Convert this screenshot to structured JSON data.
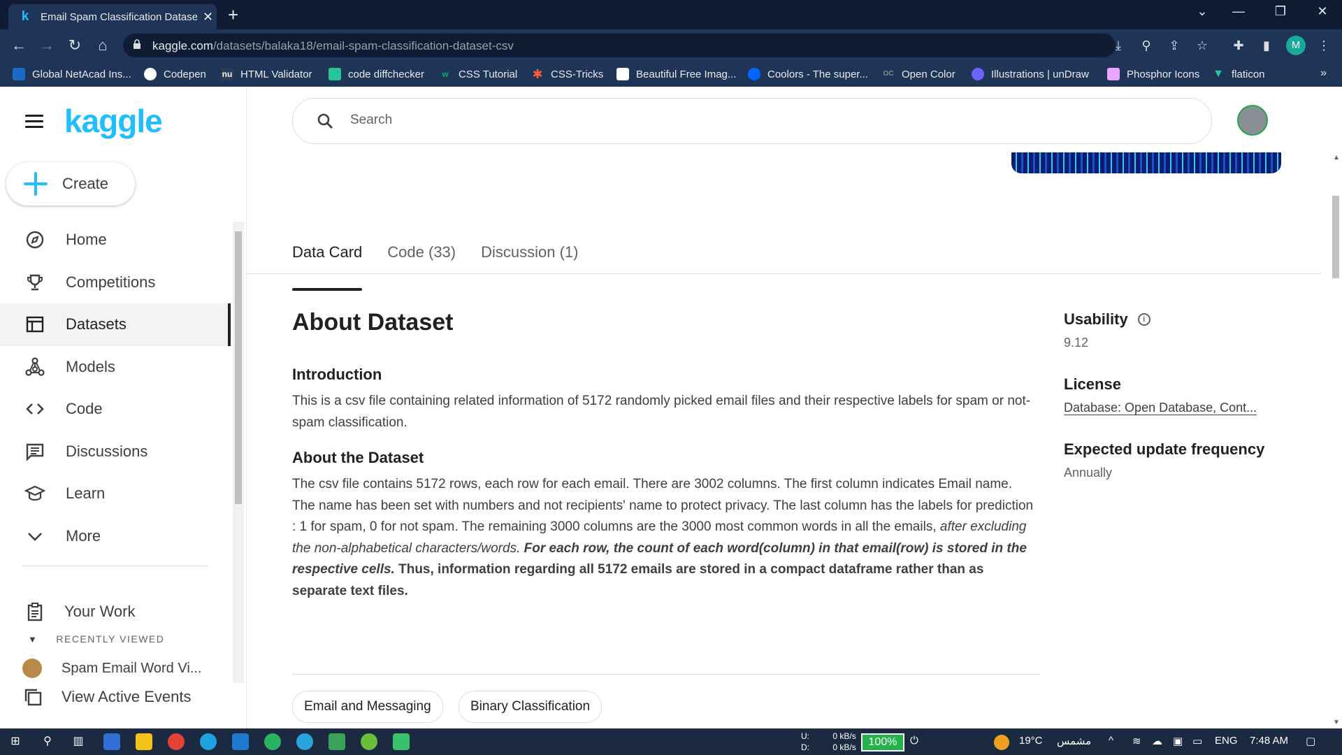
{
  "browser": {
    "tab": {
      "title": "Email Spam Classification Datase",
      "favicon": "k",
      "close": "✕"
    },
    "new_tab": "+",
    "url": {
      "host": "kaggle.com",
      "path": "/datasets/balaka18/email-spam-classification-dataset-csv"
    },
    "profile_initial": "M",
    "bookmarks": [
      {
        "label": "Global NetAcad Ins...",
        "icon": "cisco-icon",
        "color": "#1b6ac9"
      },
      {
        "label": "Codepen",
        "icon": "codepen-icon",
        "color": "#ffffff"
      },
      {
        "label": "HTML Validator",
        "icon": "validator-icon",
        "color": "#2b3a55"
      },
      {
        "label": "code diffchecker",
        "icon": "diffchecker-icon",
        "color": "#27c499"
      },
      {
        "label": "CSS Tutorial",
        "icon": "w3schools-icon",
        "color": "#04aa6d"
      },
      {
        "label": "CSS-Tricks",
        "icon": "css-tricks-icon",
        "color": "#ff5a3c"
      },
      {
        "label": "Beautiful Free Imag...",
        "icon": "unsplash-icon",
        "color": "#ffffff"
      },
      {
        "label": "Coolors - The super...",
        "icon": "coolors-icon",
        "color": "#0066ff"
      },
      {
        "label": "Open Color",
        "icon": "open-color-icon",
        "color": "#868e96"
      },
      {
        "label": "Illustrations | unDraw",
        "icon": "undraw-icon",
        "color": "#6c63ff"
      },
      {
        "label": "Phosphor Icons",
        "icon": "phosphor-icon",
        "color": "#e9a5ff"
      },
      {
        "label": "flaticon",
        "icon": "flaticon-icon",
        "color": "#27c499"
      }
    ],
    "bookmarks_more": "»"
  },
  "sidebar": {
    "logo": "kaggle",
    "create_label": "Create",
    "items": [
      {
        "label": "Home",
        "icon": "compass-icon",
        "glyph": "◎"
      },
      {
        "label": "Competitions",
        "icon": "trophy-icon",
        "glyph": "🏆"
      },
      {
        "label": "Datasets",
        "icon": "table-icon",
        "glyph": "▦"
      },
      {
        "label": "Models",
        "icon": "models-icon",
        "glyph": "⁂"
      },
      {
        "label": "Code",
        "icon": "code-icon",
        "glyph": "‹›"
      },
      {
        "label": "Discussions",
        "icon": "discussions-icon",
        "glyph": "▤"
      },
      {
        "label": "Learn",
        "icon": "learn-icon",
        "glyph": "🎓"
      },
      {
        "label": "More",
        "icon": "chevron-down-icon",
        "glyph": "⌄"
      }
    ],
    "your_work": "Your Work",
    "recently_viewed_header": "RECENTLY VIEWED",
    "recent_item": "Spam Email Word Vi...",
    "view_active_events": "View Active Events"
  },
  "header": {
    "search_placeholder": "Search"
  },
  "tabs": [
    {
      "label": "Data Card",
      "active": true
    },
    {
      "label": "Code (33)",
      "active": false
    },
    {
      "label": "Discussion (1)",
      "active": false
    }
  ],
  "content": {
    "title": "About Dataset",
    "intro_heading": "Introduction",
    "intro_text": "This is a csv file containing related information of 5172 randomly picked email files and their respective labels for spam or not-spam classification.",
    "about_heading": "About the Dataset",
    "about_text_plain": "The csv file contains 5172 rows, each row for each email. There are 3002 columns. The first column indicates Email name. The name has been set with numbers and not recipients' name to protect privacy. The last column has the labels for prediction : 1 for spam, 0 for not spam. The remaining 3000 columns are the 3000 most common words in all the emails, ",
    "about_text_italic": "after excluding the non-alphabetical characters/words.",
    "about_text_bold_italic": "For each row, the count of each word(column) in that email(row) is stored in the respective cells.",
    "about_text_bold": "Thus, information regarding all 5172 emails are stored in a compact dataframe rather than as separate text files.",
    "tags": [
      "Email and Messaging",
      "Binary Classification"
    ]
  },
  "meta": {
    "usability_label": "Usability",
    "usability_value": "9.12",
    "license_label": "License",
    "license_value": "Database: Open Database, Cont...",
    "frequency_label": "Expected update frequency",
    "frequency_value": "Annually"
  },
  "taskbar": {
    "net_up": "U:",
    "net_down": "D:",
    "net_up_rate": "0 kB/s",
    "net_down_rate": "0 kB/s",
    "battery": "100%",
    "temperature": "19°C",
    "weather": "مشمس",
    "language": "ENG",
    "time": "7:48 AM"
  }
}
